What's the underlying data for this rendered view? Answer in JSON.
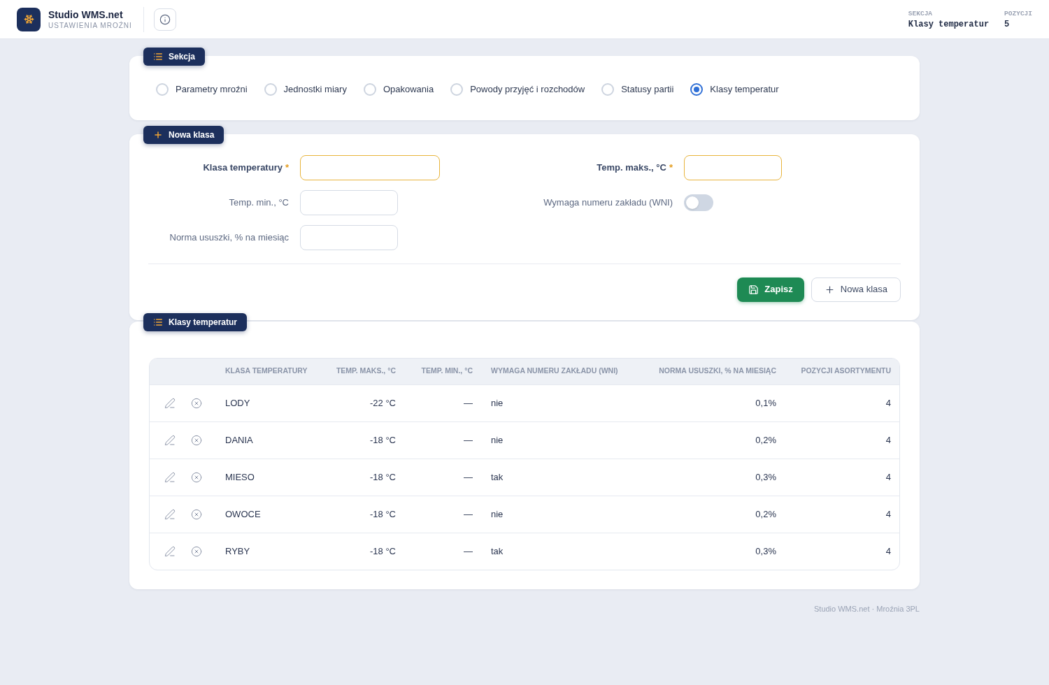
{
  "header": {
    "app_title": "Studio WMS.net",
    "app_subtitle": "USTAWIENIA MROŹNI",
    "stats": [
      {
        "label": "SEKCJA",
        "value": "Klasy temperatur"
      },
      {
        "label": "POZYCJI",
        "value": "5"
      }
    ]
  },
  "section_card": {
    "badge": "Sekcja",
    "options": [
      {
        "label": "Parametry mroźni",
        "selected": false
      },
      {
        "label": "Jednostki miary",
        "selected": false
      },
      {
        "label": "Opakowania",
        "selected": false
      },
      {
        "label": "Powody przyjęć i rozchodów",
        "selected": false
      },
      {
        "label": "Statusy partii",
        "selected": false
      },
      {
        "label": "Klasy temperatur",
        "selected": true
      }
    ]
  },
  "form_card": {
    "badge": "Nowa klasa",
    "fields": [
      {
        "kind": "text",
        "label": "Klasa temperatury",
        "required": true,
        "required_mark": "*"
      },
      {
        "kind": "number",
        "label": "Temp. maks., °C",
        "required": true,
        "required_mark": "*"
      },
      {
        "kind": "number",
        "label": "Temp. min., °C",
        "required": false
      },
      {
        "kind": "toggle",
        "label": "Wymaga numeru zakładu (WNI)",
        "on": false
      },
      {
        "kind": "number",
        "label": "Norma ususzki, % na miesiąc",
        "required": false
      }
    ],
    "buttons": [
      {
        "kind": "primary",
        "label": "Zapisz"
      },
      {
        "kind": "secondary",
        "label": "Nowa klasa"
      }
    ]
  },
  "table_card": {
    "badge": "Klasy temperatur",
    "columns": [
      "KLASA TEMPERATURY",
      "TEMP. MAKS., °C",
      "TEMP. MIN., °C",
      "WYMAGA NUMERU ZAKŁADU (WNI)",
      "NORMA USUSZKI, % NA MIESIĄC",
      "POZYCJI ASORTYMENTU"
    ],
    "rows": [
      {
        "cells": [
          "LODY",
          "-22 °C",
          "—",
          "nie",
          "0,1%",
          "4"
        ]
      },
      {
        "cells": [
          "DANIA",
          "-18 °C",
          "—",
          "nie",
          "0,2%",
          "4"
        ]
      },
      {
        "cells": [
          "MIESO",
          "-18 °C",
          "—",
          "tak",
          "0,3%",
          "4"
        ]
      },
      {
        "cells": [
          "OWOCE",
          "-18 °C",
          "—",
          "nie",
          "0,2%",
          "4"
        ]
      },
      {
        "cells": [
          "RYBY",
          "-18 °C",
          "—",
          "tak",
          "0,3%",
          "4"
        ]
      }
    ]
  },
  "footer": "Studio WMS.net · Mroźnia 3PL"
}
